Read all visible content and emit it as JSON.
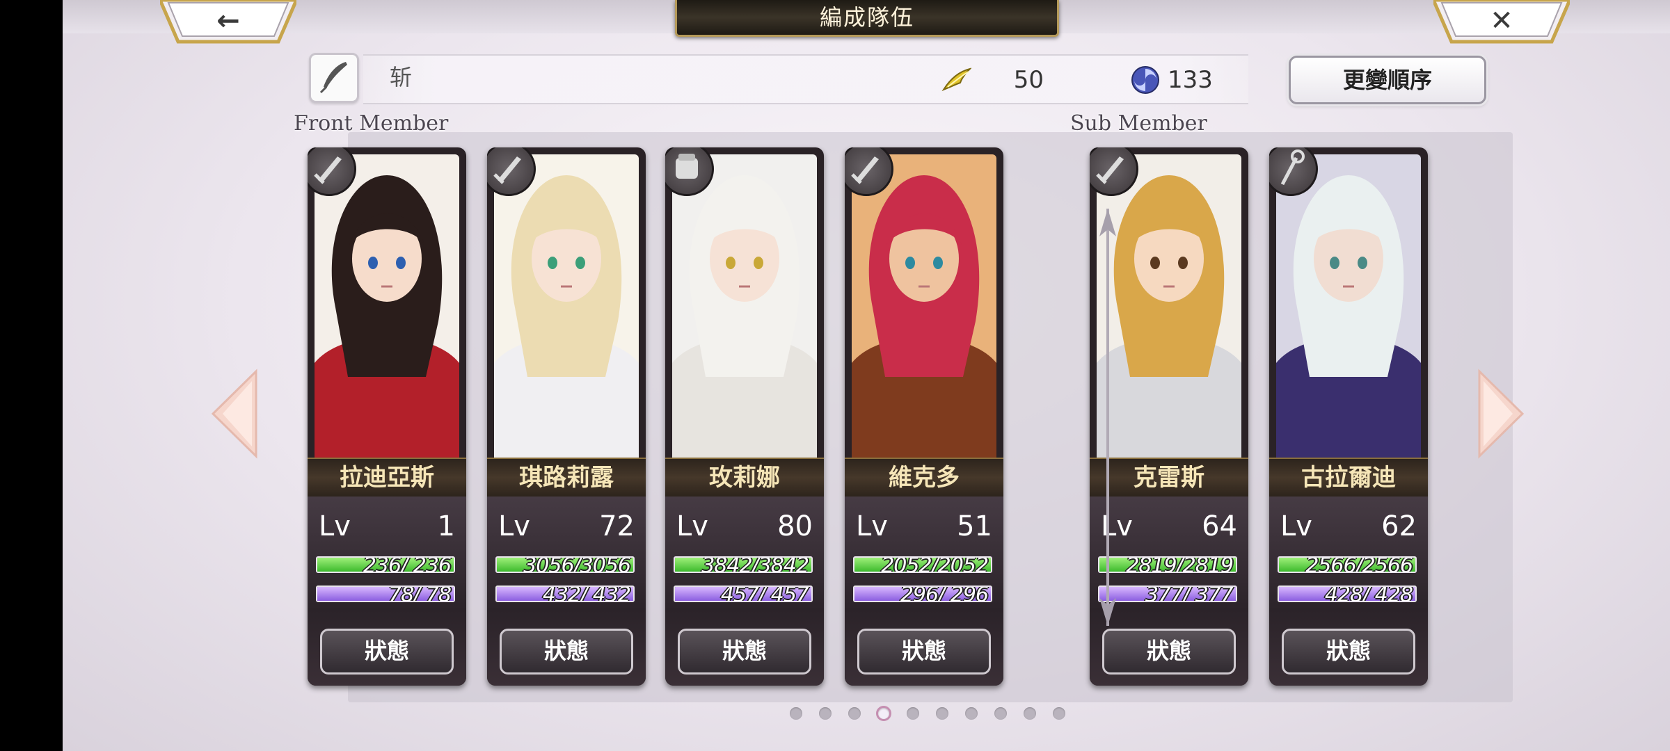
{
  "header": {
    "title": "編成隊伍",
    "back_icon": "left-arrow-icon",
    "close_icon": "close-icon",
    "back_glyph": "←",
    "close_glyph": "✕"
  },
  "party": {
    "name": "斩",
    "edit_icon": "quill-pen-icon",
    "wing_value": "50",
    "orb_value": "133",
    "order_button": "更變順序"
  },
  "sections": {
    "front": "Front Member",
    "sub": "Sub Member"
  },
  "members": [
    {
      "name": "拉迪亞斯",
      "lv_label": "Lv",
      "level": "1",
      "hp": "236/ 236",
      "mp": "78/ 78",
      "weapon": "sword-icon",
      "hp_fill": 1,
      "mp_fill": 1
    },
    {
      "name": "琪路莉露",
      "lv_label": "Lv",
      "level": "72",
      "hp": "3056/3056",
      "mp": "432/ 432",
      "weapon": "sword-icon",
      "hp_fill": 1,
      "mp_fill": 1
    },
    {
      "name": "玫莉娜",
      "lv_label": "Lv",
      "level": "80",
      "hp": "3842/3842",
      "mp": "457/ 457",
      "weapon": "gauntlet-icon",
      "hp_fill": 1,
      "mp_fill": 1
    },
    {
      "name": "維克多",
      "lv_label": "Lv",
      "level": "51",
      "hp": "2052/2052",
      "mp": "296/ 296",
      "weapon": "sword-icon",
      "hp_fill": 1,
      "mp_fill": 1
    },
    {
      "name": "克雷斯",
      "lv_label": "Lv",
      "level": "64",
      "hp": "2819/2819",
      "mp": "377/ 377",
      "weapon": "sword-icon",
      "hp_fill": 1,
      "mp_fill": 1
    },
    {
      "name": "古拉爾迪",
      "lv_label": "Lv",
      "level": "62",
      "hp": "2566/2566",
      "mp": "428/ 428",
      "weapon": "staff-icon",
      "hp_fill": 1,
      "mp_fill": 1
    }
  ],
  "status_button": "狀態",
  "pagination": {
    "total": 10,
    "active": 4
  },
  "colors": {
    "hp_bar": "#5cd03a",
    "mp_bar": "#a67af0",
    "name_text": "#f6e6b8",
    "frame_gold": "#b59a5a"
  }
}
